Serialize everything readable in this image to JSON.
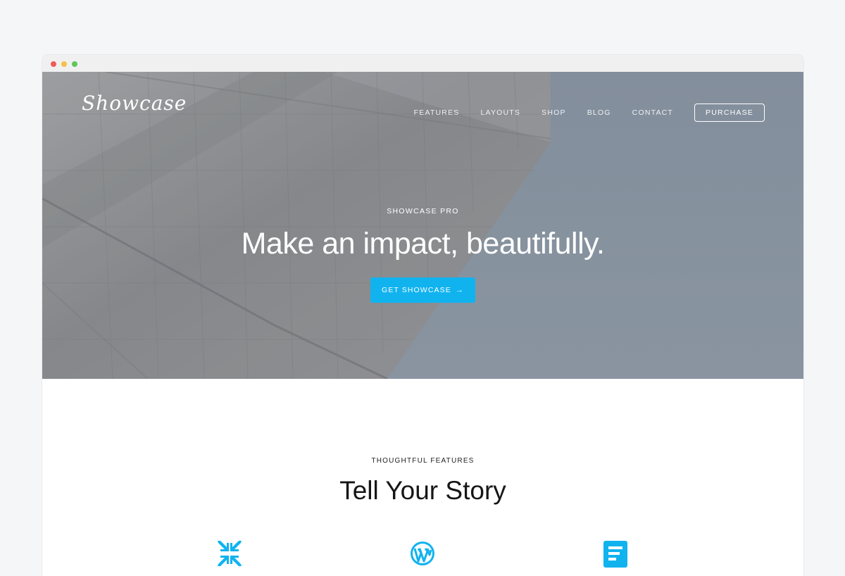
{
  "browser": {
    "window_controls": [
      "close",
      "minimize",
      "maximize"
    ]
  },
  "header": {
    "logo_text": "Showcase",
    "nav": [
      {
        "label": "FEATURES"
      },
      {
        "label": "LAYOUTS"
      },
      {
        "label": "SHOP"
      },
      {
        "label": "BLOG"
      },
      {
        "label": "CONTACT"
      }
    ],
    "purchase_label": "PURCHASE"
  },
  "hero": {
    "eyebrow": "SHOWCASE PRO",
    "headline": "Make an impact, beautifully.",
    "cta_label": "GET SHOWCASE",
    "cta_icon": "arrow-right-icon",
    "accent_color": "#11b3ef"
  },
  "features": {
    "eyebrow": "THOUGHTFUL FEATURES",
    "title": "Tell Your Story",
    "icons": [
      "compress-arrows-icon",
      "wordpress-icon",
      "document-icon"
    ]
  }
}
